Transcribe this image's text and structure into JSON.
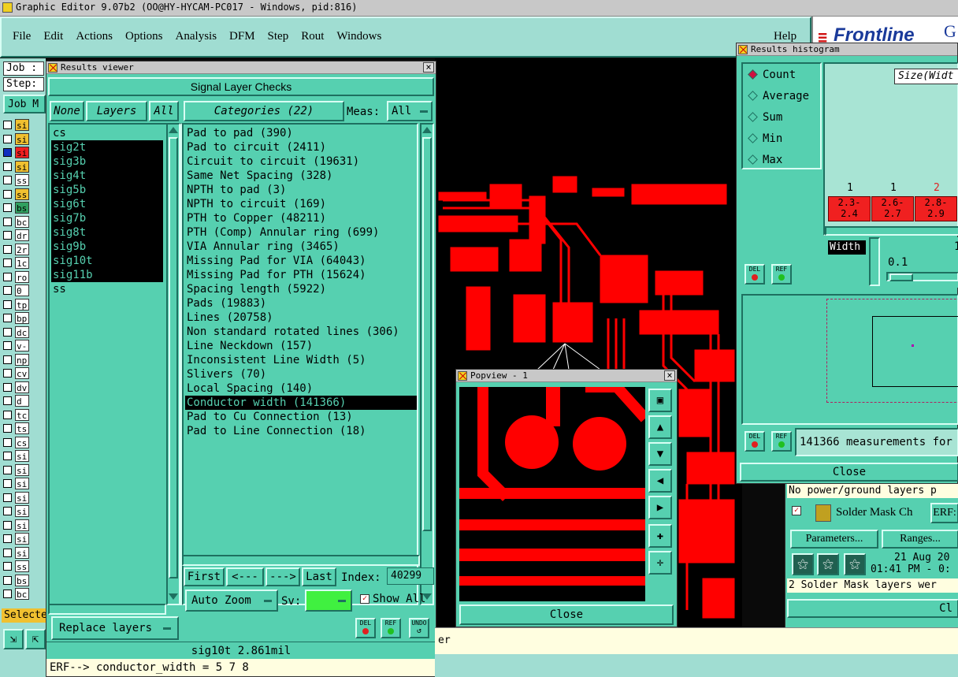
{
  "app": {
    "title": "Graphic Editor 9.07b2 (OO@HY-HYCAM-PC017 - Windows, pid:816)",
    "menu": [
      "File",
      "Edit",
      "Actions",
      "Options",
      "Analysis",
      "DFM",
      "Step",
      "Rout",
      "Windows"
    ],
    "help": "Help",
    "brand": "Frontline",
    "brand_suffix": "G"
  },
  "left_strip": {
    "job_label": "Job :",
    "step_label": "Step:",
    "job_button": "Job M",
    "layer_abbrevs": [
      "si",
      "si",
      "si",
      "si",
      "ss",
      "ss",
      "bs",
      "bc",
      "dr",
      "2r",
      "1c",
      "ro",
      "0",
      "tp",
      "bp",
      "dc",
      "v-",
      "np",
      "cv",
      "dv",
      "d",
      "tc",
      "ts",
      "cs",
      "si",
      "si",
      "si",
      "si",
      "si",
      "si",
      "si",
      "si",
      "ss",
      "bs",
      "bc"
    ],
    "selected_label": "Selecte"
  },
  "results_viewer": {
    "title": "Results viewer",
    "header": "Signal Layer Checks",
    "none_btn": "None",
    "layers_btn": "Layers",
    "all_btn": "All",
    "layers": [
      {
        "name": "cs",
        "selected": false
      },
      {
        "name": "sig2t",
        "selected": true
      },
      {
        "name": "sig3b",
        "selected": true
      },
      {
        "name": "sig4t",
        "selected": true
      },
      {
        "name": "sig5b",
        "selected": true
      },
      {
        "name": "sig6t",
        "selected": true
      },
      {
        "name": "sig7b",
        "selected": true
      },
      {
        "name": "sig8t",
        "selected": true
      },
      {
        "name": "sig9b",
        "selected": true
      },
      {
        "name": "sig10t",
        "selected": true
      },
      {
        "name": "sig11b",
        "selected": true
      },
      {
        "name": "ss",
        "selected": false
      }
    ],
    "categories_btn": "Categories (22)",
    "meas_label": "Meas:",
    "meas_value": "All",
    "categories": [
      {
        "text": "Pad to pad (390)",
        "selected": false
      },
      {
        "text": "Pad to circuit (2411)",
        "selected": false
      },
      {
        "text": "Circuit to circuit (19631)",
        "selected": false
      },
      {
        "text": "Same Net Spacing (328)",
        "selected": false
      },
      {
        "text": "NPTH to pad (3)",
        "selected": false
      },
      {
        "text": "NPTH to circuit (169)",
        "selected": false
      },
      {
        "text": "PTH to Copper (48211)",
        "selected": false
      },
      {
        "text": "PTH (Comp) Annular ring (699)",
        "selected": false
      },
      {
        "text": "VIA Annular ring (3465)",
        "selected": false
      },
      {
        "text": "Missing Pad for VIA (64043)",
        "selected": false
      },
      {
        "text": "Missing Pad for PTH (15624)",
        "selected": false
      },
      {
        "text": "Spacing length (5922)",
        "selected": false
      },
      {
        "text": "Pads (19883)",
        "selected": false
      },
      {
        "text": "Lines (20758)",
        "selected": false
      },
      {
        "text": "Non standard rotated lines (306)",
        "selected": false
      },
      {
        "text": "Line Neckdown (157)",
        "selected": false
      },
      {
        "text": "Inconsistent Line Width (5)",
        "selected": false
      },
      {
        "text": "Slivers (70)",
        "selected": false
      },
      {
        "text": "Local Spacing (140)",
        "selected": false
      },
      {
        "text": "Conductor width (141366)",
        "selected": true
      },
      {
        "text": "Pad to Cu Connection (13)",
        "selected": false
      },
      {
        "text": "Pad to Line Connection (18)",
        "selected": false
      }
    ],
    "first_btn": "First",
    "prev_btn": "<---",
    "next_btn": "--->",
    "last_btn": "Last",
    "index_label": "Index:",
    "index_value": "40299",
    "auto_zoom_btn": "Auto Zoom",
    "sv_label": "Sv:",
    "show_all_label": "Show All",
    "replace_layers_btn": "Replace layers",
    "del_label": "DEL",
    "ref_label": "REF",
    "undo_label": "UNDO",
    "status": "sig10t 2.861mil",
    "erf_line": "ERF--> conductor_width = 5 7 8"
  },
  "popview": {
    "title": "Popview - 1",
    "close": "Close"
  },
  "histogram": {
    "title": "Results histogram",
    "options": [
      {
        "label": "Count",
        "selected": true
      },
      {
        "label": "Average",
        "selected": false
      },
      {
        "label": "Sum",
        "selected": false
      },
      {
        "label": "Min",
        "selected": false
      },
      {
        "label": "Max",
        "selected": false
      }
    ],
    "size_label": "Size(Widt",
    "counts": [
      "1",
      "1",
      "2"
    ],
    "bins": [
      {
        "top": "2.3-",
        "bottom": "2.4"
      },
      {
        "top": "2.6-",
        "bottom": "2.7"
      },
      {
        "top": "2.8-",
        "bottom": "2.9"
      }
    ],
    "width_label": "Width",
    "width_value": "0.1",
    "width_right": "1",
    "measurements": "141366 measurements for",
    "close": "Close",
    "del_label": "DEL",
    "ref_label": "REF"
  },
  "solder_panel": {
    "note": "No power/ground layers p",
    "check_label": "Solder Mask Ch",
    "erf_btn": "ERF:",
    "params_btn": "Parameters...",
    "ranges_btn": "Ranges...",
    "date": "21 Aug 20",
    "time": "01:41 PM - 0:",
    "message": "2 Solder Mask layers wer",
    "close": "Cl"
  },
  "bottom": {
    "er_text": "er"
  },
  "colors": {
    "teal": "#56d0b0",
    "copper_red": "#ff0000",
    "background": "#000000"
  }
}
